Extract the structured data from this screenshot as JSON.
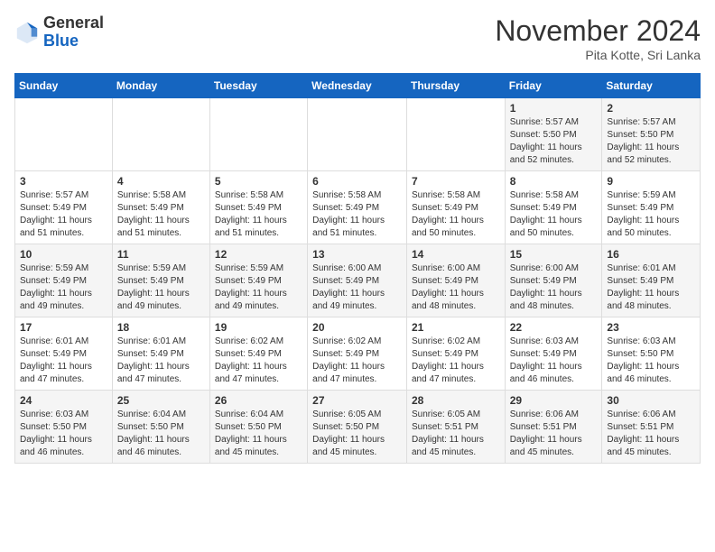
{
  "header": {
    "logo_general": "General",
    "logo_blue": "Blue",
    "month_year": "November 2024",
    "location": "Pita Kotte, Sri Lanka"
  },
  "days_of_week": [
    "Sunday",
    "Monday",
    "Tuesday",
    "Wednesday",
    "Thursday",
    "Friday",
    "Saturday"
  ],
  "weeks": [
    [
      {
        "day": "",
        "info": ""
      },
      {
        "day": "",
        "info": ""
      },
      {
        "day": "",
        "info": ""
      },
      {
        "day": "",
        "info": ""
      },
      {
        "day": "",
        "info": ""
      },
      {
        "day": "1",
        "info": "Sunrise: 5:57 AM\nSunset: 5:50 PM\nDaylight: 11 hours\nand 52 minutes."
      },
      {
        "day": "2",
        "info": "Sunrise: 5:57 AM\nSunset: 5:50 PM\nDaylight: 11 hours\nand 52 minutes."
      }
    ],
    [
      {
        "day": "3",
        "info": "Sunrise: 5:57 AM\nSunset: 5:49 PM\nDaylight: 11 hours\nand 51 minutes."
      },
      {
        "day": "4",
        "info": "Sunrise: 5:58 AM\nSunset: 5:49 PM\nDaylight: 11 hours\nand 51 minutes."
      },
      {
        "day": "5",
        "info": "Sunrise: 5:58 AM\nSunset: 5:49 PM\nDaylight: 11 hours\nand 51 minutes."
      },
      {
        "day": "6",
        "info": "Sunrise: 5:58 AM\nSunset: 5:49 PM\nDaylight: 11 hours\nand 51 minutes."
      },
      {
        "day": "7",
        "info": "Sunrise: 5:58 AM\nSunset: 5:49 PM\nDaylight: 11 hours\nand 50 minutes."
      },
      {
        "day": "8",
        "info": "Sunrise: 5:58 AM\nSunset: 5:49 PM\nDaylight: 11 hours\nand 50 minutes."
      },
      {
        "day": "9",
        "info": "Sunrise: 5:59 AM\nSunset: 5:49 PM\nDaylight: 11 hours\nand 50 minutes."
      }
    ],
    [
      {
        "day": "10",
        "info": "Sunrise: 5:59 AM\nSunset: 5:49 PM\nDaylight: 11 hours\nand 49 minutes."
      },
      {
        "day": "11",
        "info": "Sunrise: 5:59 AM\nSunset: 5:49 PM\nDaylight: 11 hours\nand 49 minutes."
      },
      {
        "day": "12",
        "info": "Sunrise: 5:59 AM\nSunset: 5:49 PM\nDaylight: 11 hours\nand 49 minutes."
      },
      {
        "day": "13",
        "info": "Sunrise: 6:00 AM\nSunset: 5:49 PM\nDaylight: 11 hours\nand 49 minutes."
      },
      {
        "day": "14",
        "info": "Sunrise: 6:00 AM\nSunset: 5:49 PM\nDaylight: 11 hours\nand 48 minutes."
      },
      {
        "day": "15",
        "info": "Sunrise: 6:00 AM\nSunset: 5:49 PM\nDaylight: 11 hours\nand 48 minutes."
      },
      {
        "day": "16",
        "info": "Sunrise: 6:01 AM\nSunset: 5:49 PM\nDaylight: 11 hours\nand 48 minutes."
      }
    ],
    [
      {
        "day": "17",
        "info": "Sunrise: 6:01 AM\nSunset: 5:49 PM\nDaylight: 11 hours\nand 47 minutes."
      },
      {
        "day": "18",
        "info": "Sunrise: 6:01 AM\nSunset: 5:49 PM\nDaylight: 11 hours\nand 47 minutes."
      },
      {
        "day": "19",
        "info": "Sunrise: 6:02 AM\nSunset: 5:49 PM\nDaylight: 11 hours\nand 47 minutes."
      },
      {
        "day": "20",
        "info": "Sunrise: 6:02 AM\nSunset: 5:49 PM\nDaylight: 11 hours\nand 47 minutes."
      },
      {
        "day": "21",
        "info": "Sunrise: 6:02 AM\nSunset: 5:49 PM\nDaylight: 11 hours\nand 47 minutes."
      },
      {
        "day": "22",
        "info": "Sunrise: 6:03 AM\nSunset: 5:49 PM\nDaylight: 11 hours\nand 46 minutes."
      },
      {
        "day": "23",
        "info": "Sunrise: 6:03 AM\nSunset: 5:50 PM\nDaylight: 11 hours\nand 46 minutes."
      }
    ],
    [
      {
        "day": "24",
        "info": "Sunrise: 6:03 AM\nSunset: 5:50 PM\nDaylight: 11 hours\nand 46 minutes."
      },
      {
        "day": "25",
        "info": "Sunrise: 6:04 AM\nSunset: 5:50 PM\nDaylight: 11 hours\nand 46 minutes."
      },
      {
        "day": "26",
        "info": "Sunrise: 6:04 AM\nSunset: 5:50 PM\nDaylight: 11 hours\nand 45 minutes."
      },
      {
        "day": "27",
        "info": "Sunrise: 6:05 AM\nSunset: 5:50 PM\nDaylight: 11 hours\nand 45 minutes."
      },
      {
        "day": "28",
        "info": "Sunrise: 6:05 AM\nSunset: 5:51 PM\nDaylight: 11 hours\nand 45 minutes."
      },
      {
        "day": "29",
        "info": "Sunrise: 6:06 AM\nSunset: 5:51 PM\nDaylight: 11 hours\nand 45 minutes."
      },
      {
        "day": "30",
        "info": "Sunrise: 6:06 AM\nSunset: 5:51 PM\nDaylight: 11 hours\nand 45 minutes."
      }
    ]
  ]
}
